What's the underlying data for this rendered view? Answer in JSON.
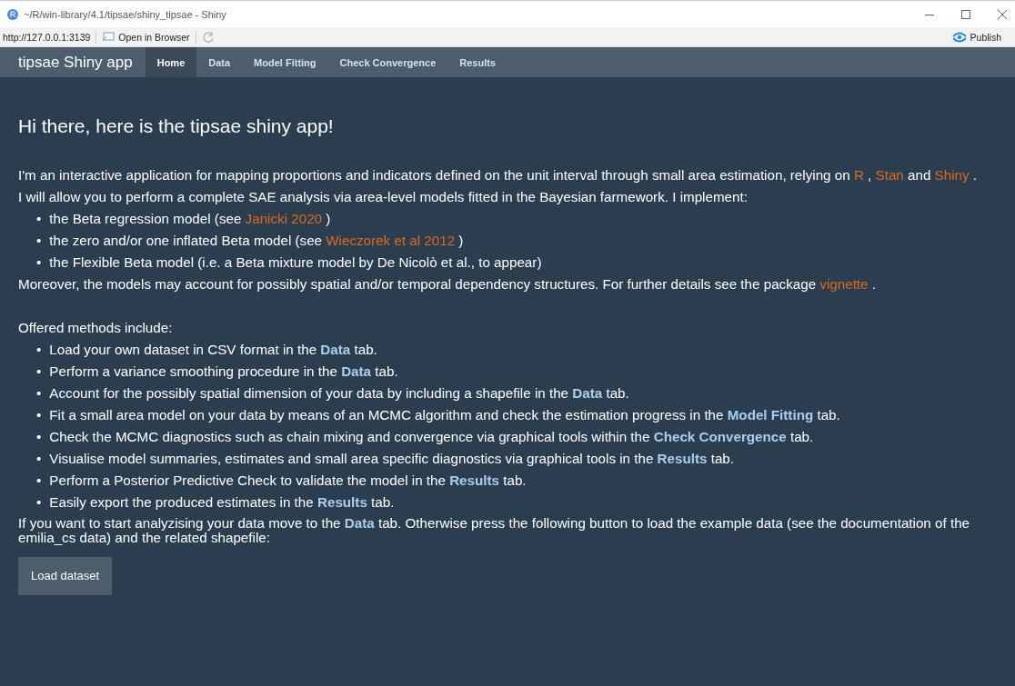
{
  "window": {
    "title": "~/R/win-library/4.1/tipsae/shiny_tipsae - Shiny"
  },
  "toolbar": {
    "url": "http://127.0.0.1:3139",
    "open_in_browser": "Open in Browser",
    "publish": "Publish"
  },
  "navbar": {
    "brand": "tipsae Shiny app",
    "tabs": [
      {
        "label": "Home",
        "selected": true
      },
      {
        "label": "Data",
        "selected": false
      },
      {
        "label": "Model Fitting",
        "selected": false
      },
      {
        "label": "Check Convergence",
        "selected": false
      },
      {
        "label": "Results",
        "selected": false
      }
    ]
  },
  "heading": "Hi there, here is the tipsae shiny app!",
  "intro": [
    [
      {
        "kind": "text",
        "text": "I'm an interactive application for mapping proportions and indicators defined on the unit interval through small area estimation, relying on "
      },
      {
        "kind": "link",
        "text": "R"
      },
      {
        "kind": "text",
        "text": " , "
      },
      {
        "kind": "link",
        "text": "Stan"
      },
      {
        "kind": "text",
        "text": " and "
      },
      {
        "kind": "link",
        "text": "Shiny"
      },
      {
        "kind": "text",
        "text": " ."
      }
    ],
    [
      {
        "kind": "text",
        "text": "I will allow you to perform a complete SAE analysis via area-level models fitted in the Bayesian farmework. I implement:"
      }
    ]
  ],
  "models": [
    {
      "marker": "•",
      "segments": [
        {
          "kind": "text",
          "text": "the Beta regression model (see "
        },
        {
          "kind": "link",
          "text": "Janicki 2020"
        },
        {
          "kind": "text",
          "text": " )"
        }
      ]
    },
    {
      "marker": "•",
      "segments": [
        {
          "kind": "text",
          "text": "the zero and/or one inflated Beta model (see "
        },
        {
          "kind": "link",
          "text": "Wieczorek et al 2012"
        },
        {
          "kind": "text",
          "text": " )"
        }
      ]
    },
    {
      "marker": "•",
      "segments": [
        {
          "kind": "text",
          "text": "the Flexible Beta model (i.e. a Beta mixture model by De Nicolò et al., to appear)"
        }
      ]
    }
  ],
  "moreover": [
    {
      "kind": "text",
      "text": "Moreover, the models may account for possibly spatial and/or temporal dependency structures. For further details see the package "
    },
    {
      "kind": "link",
      "text": "vignette"
    },
    {
      "kind": "text",
      "text": " ."
    }
  ],
  "methods_intro": "Offered methods include:",
  "methods": [
    {
      "marker": "•",
      "text": "Load your own dataset in CSV format in the **Data** tab."
    },
    {
      "marker": "•",
      "text": "Perform a variance smoothing procedure in the **Data** tab."
    },
    {
      "marker": "•",
      "text": "Account for the possibly spatial dimension of your data by including a shapefile in the **Data** tab."
    },
    {
      "marker": "•",
      "text": "Fit a small area model on your data by means of an MCMC algorithm and check the estimation progress in the **Model Fitting** tab."
    },
    {
      "marker": "•",
      "text": "Check the MCMC diagnostics such as chain mixing and convergence via graphical tools within the **Check Convergence** tab."
    },
    {
      "marker": "•",
      "text": "Visualise model summaries, estimates and small area specific diagnostics via graphical tools in the **Results** tab."
    },
    {
      "marker": "•",
      "text": "Perform a Posterior Predictive Check to validate the model in the **Results** tab."
    },
    {
      "marker": "•",
      "text": "Easily export the produced estimates in the **Results** tab."
    }
  ],
  "closing": "If you want to start analyzising your data move to the **Data** tab. Otherwise press the following button to load the example data (see the documentation of the emilia_cs data) and the related shapefile:",
  "button": "Load dataset"
}
